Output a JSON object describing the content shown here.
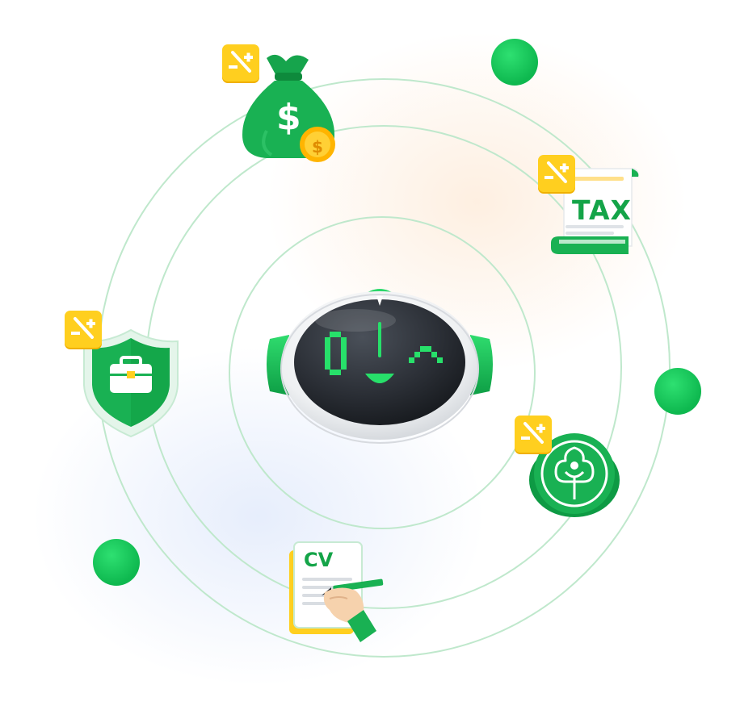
{
  "icons": {
    "money_bag": "money-bag-dollar",
    "tax_document": "tax-scroll",
    "insurance": "shield-briefcase",
    "social_fund": "tree-people-emblem",
    "cv_document": "cv-writing",
    "robot": "robot-head",
    "adjust_badge": "minus-plus-badge"
  },
  "labels": {
    "tax": "TAX",
    "cv": "CV"
  },
  "colors": {
    "brand_green": "#14a448",
    "badge_yellow": "#ffcf1f",
    "ring": "#bfe8cc",
    "robot_face": "#2b2f36"
  }
}
